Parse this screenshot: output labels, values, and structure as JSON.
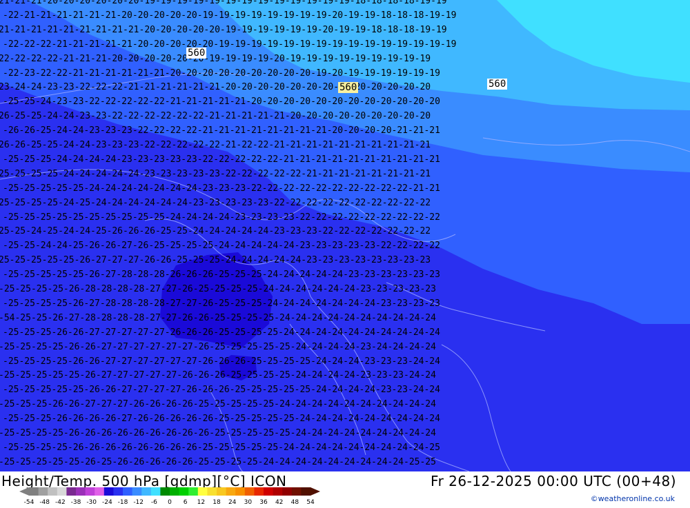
{
  "footer": {
    "title": "Height/Temp. 500 hPa [gdmp][°C] ICON",
    "valid_time": "Fr 26-12-2025 00:00 UTC (00+48)",
    "credit": "©weatheronline.co.uk"
  },
  "legend": {
    "ticks": [
      "-54",
      "-48",
      "-42",
      "-38",
      "-30",
      "-24",
      "-18",
      "-12",
      "-6",
      "0",
      "6",
      "12",
      "18",
      "24",
      "30",
      "36",
      "42",
      "48",
      "54"
    ],
    "colors": [
      "#808080",
      "#a0a0a0",
      "#c0c0c0",
      "#d8d8d8",
      "#7a2a90",
      "#9b30b8",
      "#c040d8",
      "#e060e8",
      "#1a0ad8",
      "#2a30f0",
      "#3060ff",
      "#3a8cff",
      "#40b8ff",
      "#40e0ff",
      "#008a00",
      "#00b000",
      "#00d000",
      "#30ee30",
      "#ffff40",
      "#f8e030",
      "#f8c820",
      "#f8a810",
      "#f89000",
      "#f06000",
      "#e82800",
      "#d00000",
      "#b00000",
      "#900000",
      "#701000",
      "#501000"
    ]
  },
  "map": {
    "height_labels": [
      "560",
      "560",
      "560"
    ],
    "temperature_rows": [
      "21-21-21-20-20-20-20-20-20-19-19-19-19-19-19-19-19-19-19-19-19-19-18-18-18-18-19-19",
      "-22-21-21-21-21-21-21-20-20-20-20-20-19-19-19-19-19-19-19-19-20-19-19-18-18-18-19-19",
      "21-21-21-21-21-21-21-21-21-20-20-20-20-20-19-19-19-19-19-19-20-19-19-18-18-18-19-19",
      "-22-22-22-21-21-21-21-21-20-20-20-20-20-19-19-19-19-19-19-19-19-19-19-19-19-19-19-19",
      "22-22-22-22-21-21-21-20-20-20-20-20-20-19-19-19-19-20-19-19-19-19-19-19-19-19-19",
      "-22-23-22-22-21-21-21-21-21-21-20-20-20-20-20-20-20-20-20-19-20-19-19-19-19-19-19",
      "23-24-24-23-23-22-22-22-21-21-21-21-21-21-20-20-20-20-20-20-20-20-20-20-20-20-20",
      "-25-25-24-23-23-22-22-22-22-22-21-21-21-21-21-20-20-20-20-20-20-20-20-20-20-20-20",
      "26-25-25-24-24-23-23-22-22-22-22-22-22-21-21-21-21-21-20-20-20-20-20-20-20-20-20",
      "-26-26-25-24-24-23-23-23-22-22-22-22-21-21-21-21-21-21-21-21-20-20-20-20-21-21-21",
      "26-26-25-25-24-24-23-23-23-22-22-22-22-22-21-22-22-21-21-21-21-21-21-21-21-21-21",
      "-25-25-25-24-24-24-24-23-23-23-23-23-22-22-22-22-22-21-21-21-21-21-21-21-21-21-21",
      "25-25-25-25-24-24-24-24-24-23-23-23-23-23-22-22-22-22-22-21-21-21-21-21-21-21-21",
      "-25-25-25-25-25-24-24-24-24-24-24-24-23-23-23-22-22-22-22-22-22-22-22-22-22-21-21",
      "25-25-25-25-24-25-24-24-24-24-24-24-23-23-23-23-23-22-22-22-22-22-22-22-22-22-22",
      "-25-25-25-25-25-25-25-25-25-25-24-24-24-24-23-23-23-23-22-22-22-22-22-22-22-22-22",
      "25-25-24-25-24-24-25-26-26-26-25-25-24-24-24-24-24-23-23-23-22-22-22-22-22-22-22",
      "-25-25-24-24-25-26-26-27-26-25-25-25-25-24-24-24-24-24-23-23-23-23-23-22-22-22-22",
      "25-25-25-25-25-26-27-27-27-26-26-25-25-25-24-24-24-24-24-23-23-23-23-23-23-23-23",
      "-25-25-25-25-25-26-27-28-28-28-26-26-26-25-25-25-24-24-24-24-24-23-23-23-23-23-23",
      "-25-25-25-25-26-28-28-28-28-27-27-26-25-25-25-25-24-24-24-24-24-24-23-23-23-23-23",
      "-25-25-25-25-26-27-28-28-28-28-27-27-26-25-25-25-24-24-24-24-24-24-24-23-23-23-23",
      "-54-25-25-26-27-28-28-28-28-27-27-26-26-25-25-25-25-24-24-24-24-24-24-24-24-24-24",
      "-25-25-25-26-26-27-27-27-27-27-26-26-26-25-25-25-25-24-24-24-24-24-24-24-24-24-24",
      "-25-25-25-25-26-26-27-27-27-27-27-27-26-25-25-25-25-25-24-24-24-24-23-24-24-24-24",
      "-25-25-25-25-26-26-27-27-27-27-27-27-26-26-26-25-25-25-25-24-24-24-23-23-23-24-24",
      "-25-25-25-25-25-26-27-27-27-27-27-26-26-26-25-25-25-25-24-24-24-24-23-23-23-24-24",
      "-25-25-25-25-25-26-26-27-27-27-27-26-26-26-25-25-25-25-25-24-24-24-24-23-23-24-24",
      "-25-25-25-26-26-27-27-27-26-26-26-26-25-25-25-25-25-24-24-24-24-24-24-24-24-24-24",
      "-25-25-25-26-26-26-26-27-26-26-26-26-26-25-25-25-25-25-24-24-24-24-24-24-24-24-24",
      "-25-25-25-25-26-26-26-26-26-26-26-26-26-25-25-25-25-25-24-24-24-24-24-24-24-24-24",
      "-25-25-25-25-26-26-26-26-26-26-26-26-25-25-25-25-25-24-24-24-24-24-24-24-24-24-25",
      "-25-25-25-25-25-26-25-26-26-26-26-26-25-25-25-25-24-24-24-24-24-24-24-24-24-25-25"
    ]
  }
}
